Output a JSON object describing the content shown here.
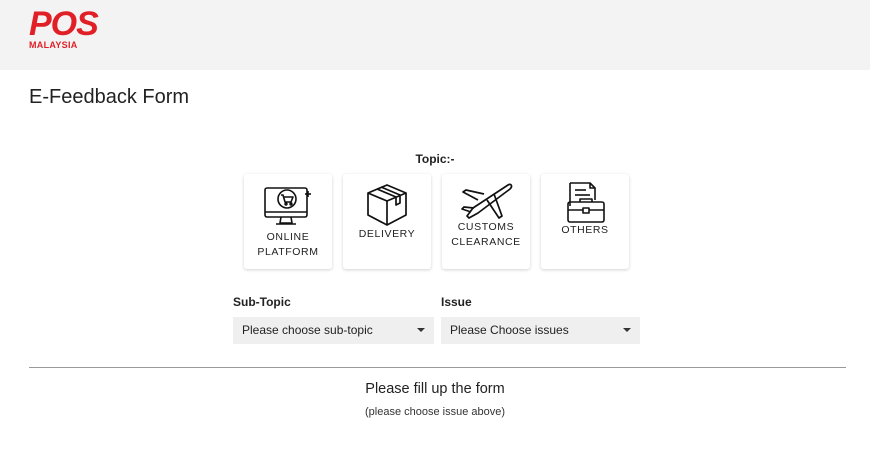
{
  "brand": {
    "word": "POS",
    "sub": "MALAYSIA",
    "color": "#e01f26"
  },
  "page_title": "E-Feedback Form",
  "topic": {
    "label": "Topic:-",
    "cards": [
      {
        "lines": [
          "ONLINE",
          "PLATFORM"
        ],
        "icon": "computer-cart-icon"
      },
      {
        "lines": [
          "DELIVERY"
        ],
        "icon": "box-icon"
      },
      {
        "lines": [
          "CUSTOMS",
          "CLEARANCE"
        ],
        "icon": "airplane-icon"
      },
      {
        "lines": [
          "OTHERS"
        ],
        "icon": "briefcase-document-icon"
      }
    ]
  },
  "subtopic": {
    "label": "Sub-Topic",
    "value": "Please choose sub-topic"
  },
  "issue": {
    "label": "Issue",
    "value": "Please Choose issues"
  },
  "form_message": {
    "title": "Please fill up the form",
    "subtitle": "(please choose issue above)"
  }
}
